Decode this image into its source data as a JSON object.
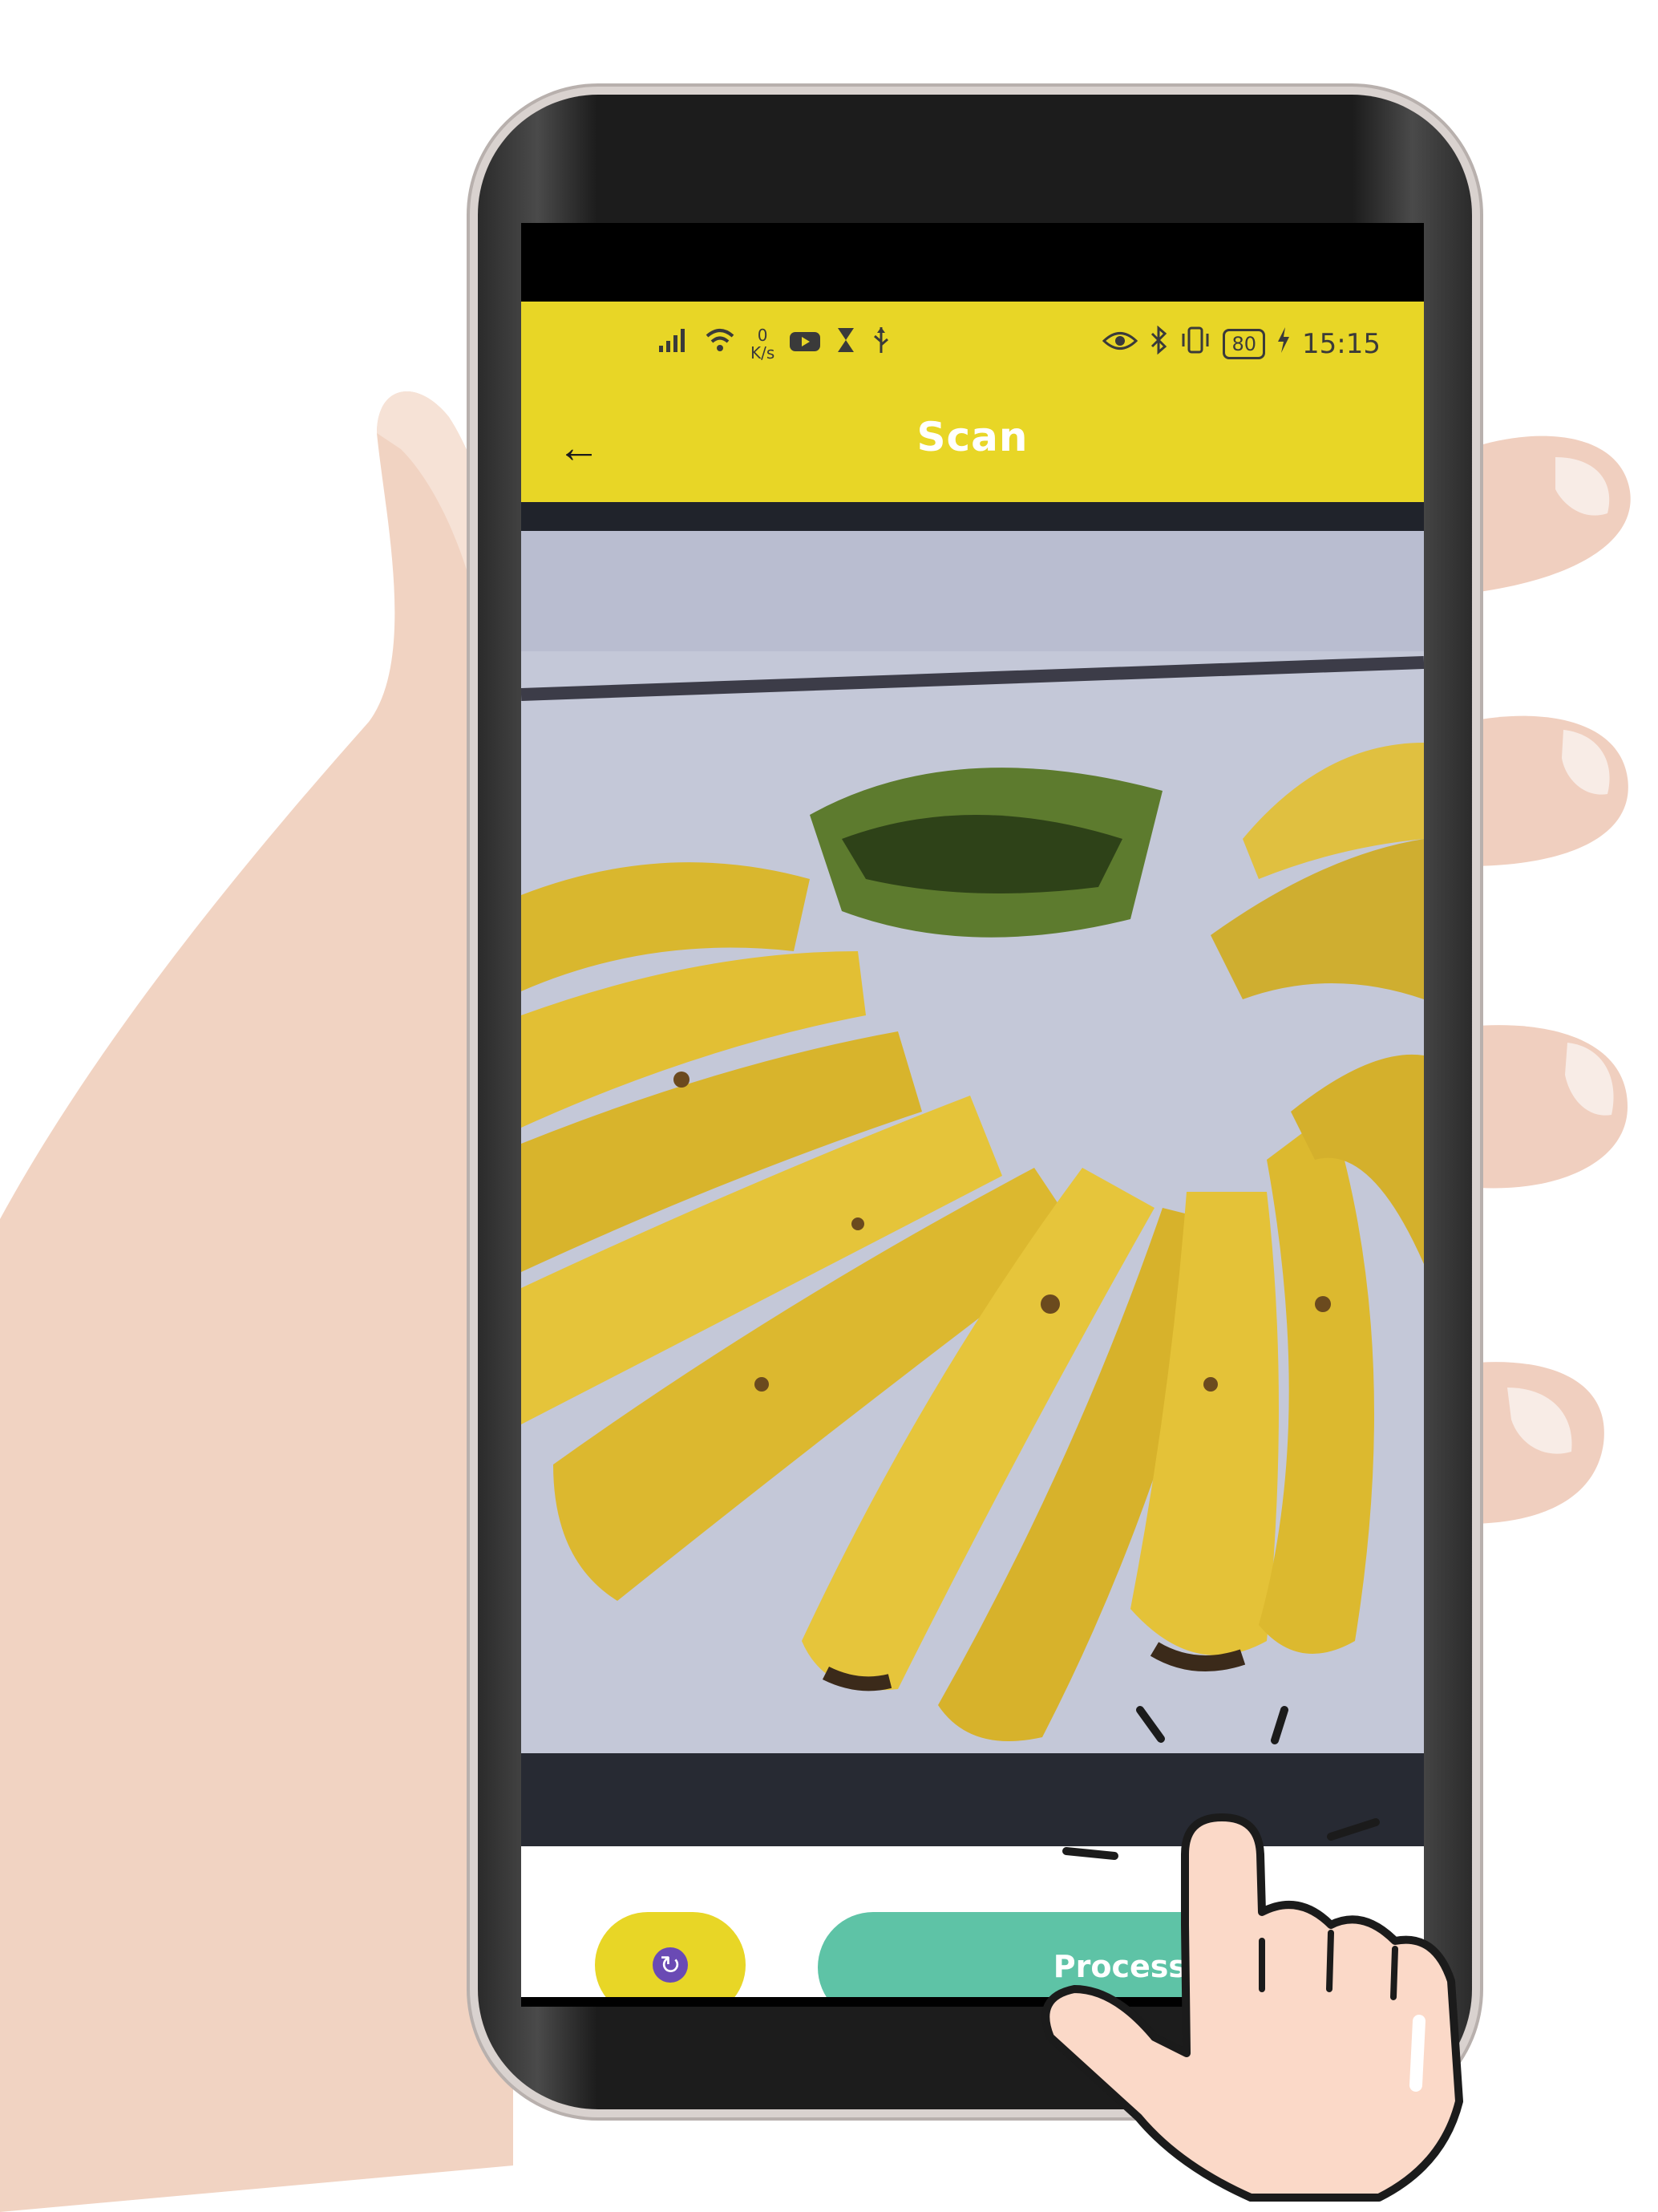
{
  "status_bar": {
    "net_speed_value": "0",
    "net_speed_unit": "K/s",
    "battery": "80",
    "time": "15:15"
  },
  "app_bar": {
    "title": "Scan",
    "back_glyph": "←"
  },
  "camera": {
    "subject": "banana-bunch-preview"
  },
  "controls": {
    "switch_camera_icon": "camera-switch-icon",
    "process_label": "Process"
  },
  "colors": {
    "app_bar": "#e8d626",
    "process_button": "#5ec3a6",
    "switch_button": "#e8d626",
    "switch_icon": "#6a4ab4"
  }
}
